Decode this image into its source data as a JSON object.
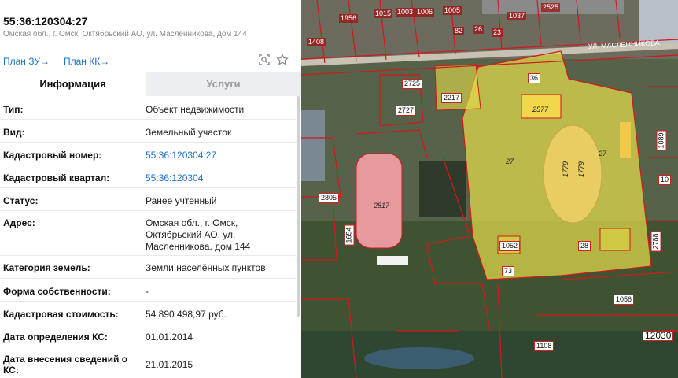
{
  "header": {
    "cadastral_title": "55:36:120304:27",
    "address_line": "Омская обл., г. Омск, Октябрьский АО, ул. Масленникова, дом 144",
    "plan_zu_label": "План ЗУ",
    "plan_kk_label": "План КК",
    "arrow": "→"
  },
  "tabs": [
    {
      "label": "Информация",
      "active": true
    },
    {
      "label": "Услуги",
      "active": false
    }
  ],
  "fields": [
    {
      "key": "Тип:",
      "value": "Объект недвижимости"
    },
    {
      "key": "Вид:",
      "value": "Земельный участок"
    },
    {
      "key": "Кадастровый номер:",
      "value": "55:36:120304:27",
      "link": true
    },
    {
      "key": "Кадастровый квартал:",
      "value": "55:36:120304",
      "link": true
    },
    {
      "key": "Статус:",
      "value": "Ранее учтенный"
    },
    {
      "key": "Адрес:",
      "value": "Омская обл., г. Омск, Октябрьский АО, ул. Масленникова, дом 144"
    },
    {
      "key": "Категория земель:",
      "value": "Земли населённых пунктов"
    },
    {
      "key": "Форма собственности:",
      "value": "-"
    },
    {
      "key": "Кадастровая стоимость:",
      "value": "54 890 498,97 руб."
    },
    {
      "key": "Дата определения КС:",
      "value": "01.01.2014"
    },
    {
      "key": "Дата внесения сведений о КС:",
      "value": "21.01.2015"
    }
  ],
  "map": {
    "street_label": "УЛ. МАСЛЕННИКОВА",
    "parcel_labels": [
      "1408",
      "1956",
      "1015",
      "1003",
      "1006",
      "1005",
      "1037",
      "2525",
      "82",
      "26",
      "23",
      "36",
      "2725",
      "2217",
      "2727",
      "2577",
      "27",
      "27",
      "1779",
      "1779",
      "2817",
      "2805",
      "1654",
      "1052",
      "73",
      "28",
      "2788",
      "1089",
      "1056",
      "1108",
      "10",
      "12030"
    ],
    "stadium_label": "2817"
  },
  "colors": {
    "link": "#1d73c9",
    "parcel_fill": "#e8e04a",
    "parcel_border": "#d11a1a",
    "stadium": "#e79a9e"
  }
}
